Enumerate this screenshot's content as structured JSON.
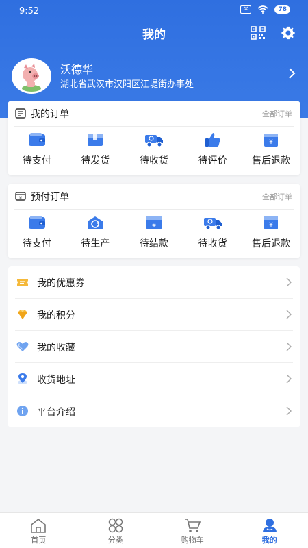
{
  "status": {
    "time": "9:52",
    "battery": "78"
  },
  "header": {
    "title": "我的"
  },
  "profile": {
    "name": "沃德华",
    "address": "湖北省武汉市汉阳区江堤街办事处"
  },
  "my_orders": {
    "title": "我的订单",
    "all_link": "全部订单",
    "items": [
      {
        "label": "待支付",
        "icon": "wallet-icon"
      },
      {
        "label": "待发货",
        "icon": "package-icon"
      },
      {
        "label": "待收货",
        "icon": "truck-icon"
      },
      {
        "label": "待评价",
        "icon": "thumbs-up-icon"
      },
      {
        "label": "售后退款",
        "icon": "refund-icon"
      }
    ]
  },
  "prepaid_orders": {
    "title": "预付订单",
    "all_link": "全部订单",
    "items": [
      {
        "label": "待支付",
        "icon": "wallet-icon"
      },
      {
        "label": "待生产",
        "icon": "production-icon"
      },
      {
        "label": "待结款",
        "icon": "yen-icon"
      },
      {
        "label": "待收货",
        "icon": "truck-icon"
      },
      {
        "label": "售后退款",
        "icon": "refund-icon"
      }
    ]
  },
  "menu": [
    {
      "label": "我的优惠券",
      "icon": "coupon-icon"
    },
    {
      "label": "我的积分",
      "icon": "diamond-icon"
    },
    {
      "label": "我的收藏",
      "icon": "heart-icon"
    },
    {
      "label": "收货地址",
      "icon": "location-icon"
    },
    {
      "label": "平台介绍",
      "icon": "info-icon"
    }
  ],
  "tabbar": [
    {
      "label": "首页",
      "icon": "home-icon",
      "active": false
    },
    {
      "label": "分类",
      "icon": "category-icon",
      "active": false
    },
    {
      "label": "购物车",
      "icon": "cart-icon",
      "active": false
    },
    {
      "label": "我的",
      "icon": "user-icon",
      "active": true
    }
  ],
  "colors": {
    "primary": "#2f6fe0",
    "icon_blue": "#3b7bea",
    "coupon": "#f5b93a",
    "diamond": "#f5b93a"
  }
}
